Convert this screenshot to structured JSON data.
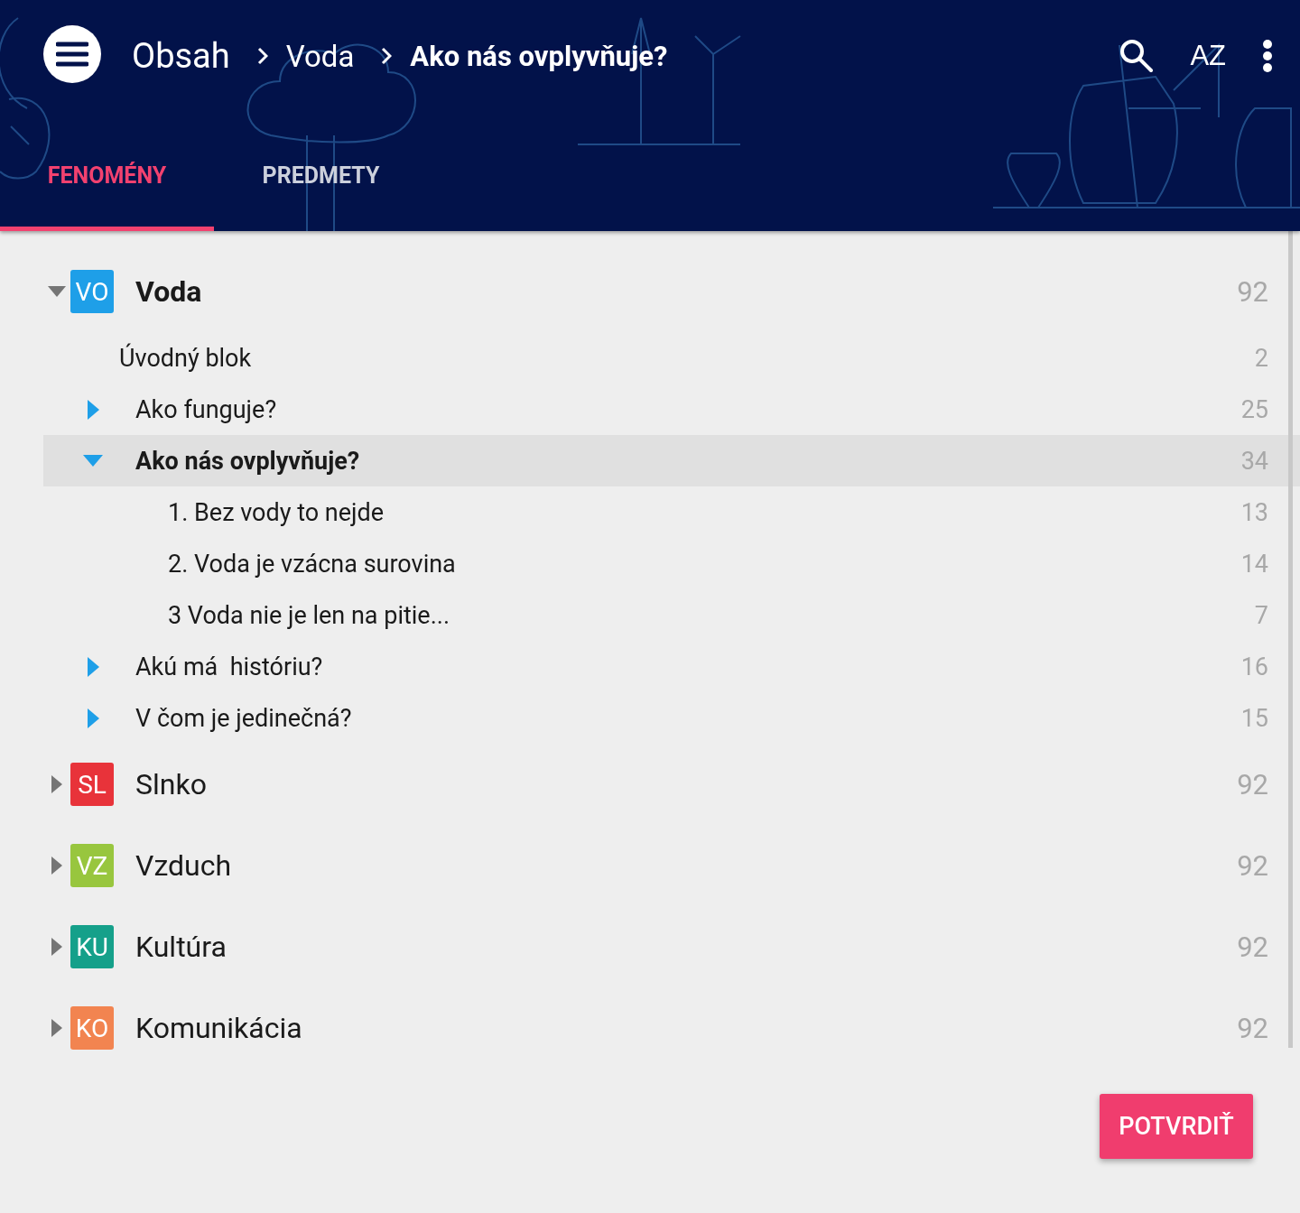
{
  "header": {
    "breadcrumbs": [
      {
        "label": "Obsah",
        "current": false
      },
      {
        "label": "Voda",
        "current": false
      },
      {
        "label": "Ako nás ovplyvňuje?",
        "current": true
      }
    ],
    "sort_label": "AZ"
  },
  "tabs": [
    {
      "label": "FENOMÉNY",
      "selected": true
    },
    {
      "label": "PREDMETY",
      "selected": false
    }
  ],
  "tree": [
    {
      "code": "VO",
      "color": "#1e9fe8",
      "label": "Voda",
      "count": "92",
      "expanded": true,
      "children": [
        {
          "kind": "leaf",
          "label": "Úvodný blok",
          "count": "2",
          "selected": false
        },
        {
          "kind": "branch",
          "label": "Ako funguje?",
          "count": "25",
          "expanded": false,
          "selected": false
        },
        {
          "kind": "branch",
          "label": "Ako nás ovplyvňuje?",
          "count": "34",
          "expanded": true,
          "selected": true,
          "children": [
            {
              "kind": "leaf",
              "label": "1. Bez vody to nejde",
              "count": "13",
              "selected": false
            },
            {
              "kind": "leaf",
              "label": "2. Voda je vzácna surovina",
              "count": "14",
              "selected": false
            },
            {
              "kind": "leaf",
              "label": "3 Voda nie je len na pitie...",
              "count": "7",
              "selected": false
            }
          ]
        },
        {
          "kind": "branch",
          "label": "Akú má  históriu?",
          "count": "16",
          "expanded": false,
          "selected": false
        },
        {
          "kind": "branch",
          "label": "V čom je jedinečná?",
          "count": "15",
          "expanded": false,
          "selected": false
        }
      ]
    },
    {
      "code": "SL",
      "color": "#e8333a",
      "label": "Slnko",
      "count": "92",
      "expanded": false
    },
    {
      "code": "VZ",
      "color": "#98c63e",
      "label": "Vzduch",
      "count": "92",
      "expanded": false
    },
    {
      "code": "KU",
      "color": "#15a08a",
      "label": "Kultúra",
      "count": "92",
      "expanded": false
    },
    {
      "code": "KO",
      "color": "#f28450",
      "label": "Komunikácia",
      "count": "92",
      "expanded": false
    }
  ],
  "confirm_button": "POTVRDIŤ"
}
